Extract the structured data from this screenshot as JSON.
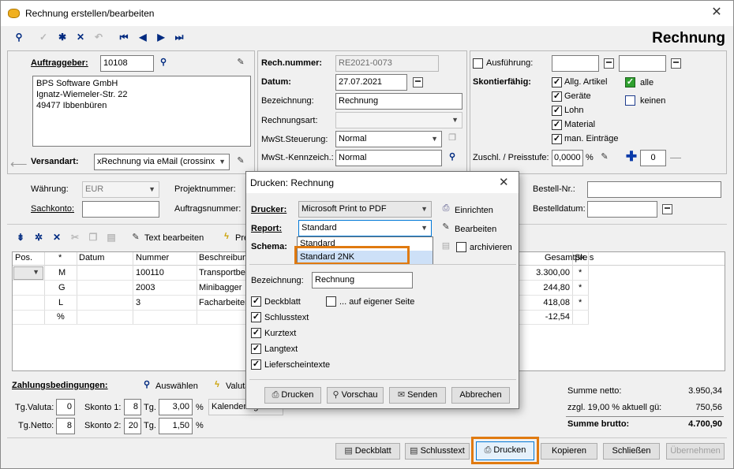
{
  "window": {
    "title": "Rechnung erstellen/bearbeiten",
    "heading": "Rechnung"
  },
  "icons": {
    "app": "app-logo-icon",
    "close": "close-icon",
    "search": "search-icon",
    "check": "checkmark-icon",
    "new": "asterisk-icon",
    "delete": "x-icon",
    "undo": "undo-icon",
    "first": "first-record-icon",
    "prev": "prev-record-icon",
    "next": "next-record-icon",
    "last": "last-record-icon",
    "edit": "edit-pencil-icon",
    "calendar": "calendar-icon",
    "printer": "printer-icon",
    "plus": "plus-icon"
  },
  "customer": {
    "label": "Auftraggeber:",
    "number": "10108",
    "address": [
      "BPS Software GmbH",
      "Ignatz-Wiemeler-Str. 22",
      "49477 Ibbenbüren"
    ],
    "shipping_label": "Versandart:",
    "shipping_value": "xRechnung via eMail (crossinx"
  },
  "invoice": {
    "number_label": "Rech.nummer:",
    "number": "RE2021-0073",
    "date_label": "Datum:",
    "date": "27.07.2021",
    "desc_label": "Bezeichnung:",
    "desc": "Rechnung",
    "type_label": "Rechnungsart:",
    "type": "",
    "vat_label": "MwSt.Steuerung:",
    "vat": "Normal",
    "vatcode_label": "MwSt.-Kennzeich.:",
    "vatcode": "Normal"
  },
  "right": {
    "execution_label": "Ausführung:",
    "discount_label": "Skontierfähig:",
    "items": [
      "Allg. Artikel",
      "Geräte",
      "Lohn",
      "Material",
      "man. Einträge"
    ],
    "all_label": "alle",
    "none_label": "keinen",
    "surcharge_label": "Zuschl. / Preisstufe:",
    "surcharge": "0,0000",
    "surcharge_unit": "%",
    "level": "0"
  },
  "meta": {
    "currency_label": "Währung:",
    "currency": "EUR",
    "project_label": "Projektnummer:",
    "account_label": "Sachkonto:",
    "order_label": "Auftragsnummer:",
    "ordernr_label": "Bestell-Nr.:",
    "orderdate_label": "Bestelldatum:"
  },
  "positions": {
    "toolbar_edit": "Text bearbeiten",
    "toolbar_pre": "Pre",
    "columns": [
      "Pos.",
      "*",
      "Datum",
      "Nummer",
      "Beschreibun",
      "Gesamtpreis",
      "Sk."
    ],
    "rows": [
      {
        "type": "M",
        "number": "100110",
        "desc": "Transportbe",
        "total": "3.300,00",
        "sk": "*"
      },
      {
        "type": "G",
        "number": "2003",
        "desc": "Minibagger",
        "total": "244,80",
        "sk": "*"
      },
      {
        "type": "L",
        "number": "3",
        "desc": "Facharbeiter",
        "total": "418,08",
        "sk": "*"
      },
      {
        "type": "%",
        "number": "",
        "desc": "",
        "total": "-12,54",
        "sk": ""
      }
    ]
  },
  "payment": {
    "title": "Zahlungsbedingungen:",
    "select": "Auswählen",
    "valuta_btn": "Valuta",
    "valuta_label": "Tg.Valuta:",
    "valuta": "0",
    "netto_label": "Tg.Netto:",
    "netto": "8",
    "skonto1_label": "Skonto 1:",
    "skonto1_days": "8",
    "skonto1_pct": "3,00",
    "skonto2_label": "Skonto 2:",
    "skonto2_days": "20",
    "skonto2_pct": "1,50",
    "tg": "Tg.",
    "pct": "%",
    "calendar": "Kalendertage"
  },
  "totals": {
    "net_label": "Summe netto:",
    "net": "3.950,34",
    "vat_label": "zzgl. 19,00 % aktuell gü:",
    "vat": "750,56",
    "gross_label": "Summe brutto:",
    "gross": "4.700,90"
  },
  "buttons": {
    "deckblatt": "Deckblatt",
    "schlusstext": "Schlusstext",
    "drucken": "Drucken",
    "kopieren": "Kopieren",
    "schliessen": "Schließen",
    "uebernehmen": "Übernehmen"
  },
  "dialog": {
    "title": "Drucken: Rechnung",
    "printer_label": "Drucker:",
    "printer": "Microsoft Print to PDF",
    "setup": "Einrichten",
    "report_label": "Report:",
    "report": "Standard",
    "edit": "Bearbeiten",
    "schema_label": "Schema:",
    "archive": "archivieren",
    "options": [
      "Standard",
      "Standard 2NK"
    ],
    "desc_label": "Bezeichnung:",
    "desc": "Rechnung",
    "checks": [
      {
        "label": "Deckblatt",
        "checked": true
      },
      {
        "label": "Schlusstext",
        "checked": true
      },
      {
        "label": "Kurztext",
        "checked": true
      },
      {
        "label": "Langtext",
        "checked": true
      },
      {
        "label": "Lieferscheintexte",
        "checked": true
      }
    ],
    "own_page": "... auf eigener Seite",
    "print": "Drucken",
    "preview": "Vorschau",
    "send": "Senden",
    "cancel": "Abbrechen"
  },
  "colors": {
    "highlight": "#e07a10",
    "navy": "#002a80",
    "selection": "#cde0f7"
  }
}
